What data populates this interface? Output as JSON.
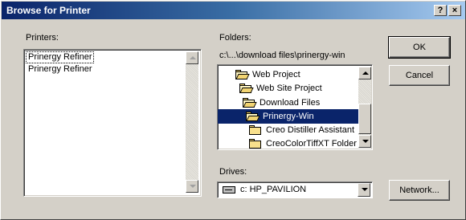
{
  "window": {
    "title": "Browse for Printer",
    "help_label": "?",
    "close_label": "×"
  },
  "printers": {
    "label": "Printers:",
    "field_value": "Prinergy Refiner",
    "items": [
      "Prinergy Refiner"
    ]
  },
  "folders": {
    "label": "Folders:",
    "path": "c:\\...\\download files\\prinergy-win",
    "items": [
      {
        "name": "Web Project",
        "icon": "open-folder-icon"
      },
      {
        "name": "Web Site Project",
        "icon": "open-folder-icon"
      },
      {
        "name": "Download Files",
        "icon": "open-folder-icon"
      },
      {
        "name": "Prinergy-Win",
        "icon": "open-folder-icon",
        "selected": true
      },
      {
        "name": "Creo Distiller Assistant",
        "icon": "folder-icon"
      },
      {
        "name": "CreoColorTiffXT Folder",
        "icon": "folder-icon"
      }
    ]
  },
  "drives": {
    "label": "Drives:",
    "selected": "c: HP_PAVILION"
  },
  "buttons": {
    "ok": "OK",
    "cancel": "Cancel",
    "network": "Network..."
  },
  "colors": {
    "selection": "#0a246a",
    "face": "#d4d0c8"
  }
}
